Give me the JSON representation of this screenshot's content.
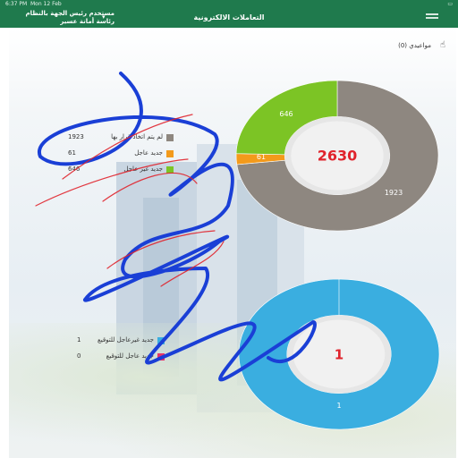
{
  "statusbar": {
    "time": "6:37 PM",
    "date": "Mon 12 Feb",
    "battery": "▭"
  },
  "appbar": {
    "title": "التعاملات الالكترونية",
    "user_line1": "مستخدم رئيس الجهة بالنظام",
    "user_line2": "رئاسة أمانة عسير"
  },
  "appointments": {
    "label": "مواعيدي (0)",
    "icon": "hand-icon"
  },
  "chart_data": [
    {
      "type": "pie",
      "categories": [
        "لم يتم اتخاذ قرار بها",
        "جديد عاجل",
        "جديد غير عاجل"
      ],
      "values": [
        1923,
        61,
        646
      ],
      "total": "2630",
      "colors": [
        "#8e8780",
        "#f39a1b",
        "#7cc425"
      ]
    },
    {
      "type": "pie",
      "categories": [
        "جديد غيرعاجل للتوقيع",
        "جديد عاجل للتوقيع"
      ],
      "values": [
        1,
        0
      ],
      "total": "1",
      "colors": [
        "#3aaee0",
        "#e6336a"
      ]
    }
  ],
  "legend1": [
    {
      "label": "لم يتم اتخاذ قرار بها",
      "value": "1923",
      "color": "#8e8780"
    },
    {
      "label": "جديد عاجل",
      "value": "61",
      "color": "#f39a1b"
    },
    {
      "label": "جديد غير عاجل",
      "value": "646",
      "color": "#7cc425"
    }
  ],
  "legend2": [
    {
      "label": "جديد غيرعاجل للتوقيع",
      "value": "1",
      "color": "#3aaee0"
    },
    {
      "label": "جديد عاجل للتوقيع",
      "value": "0",
      "color": "#e6336a"
    }
  ]
}
